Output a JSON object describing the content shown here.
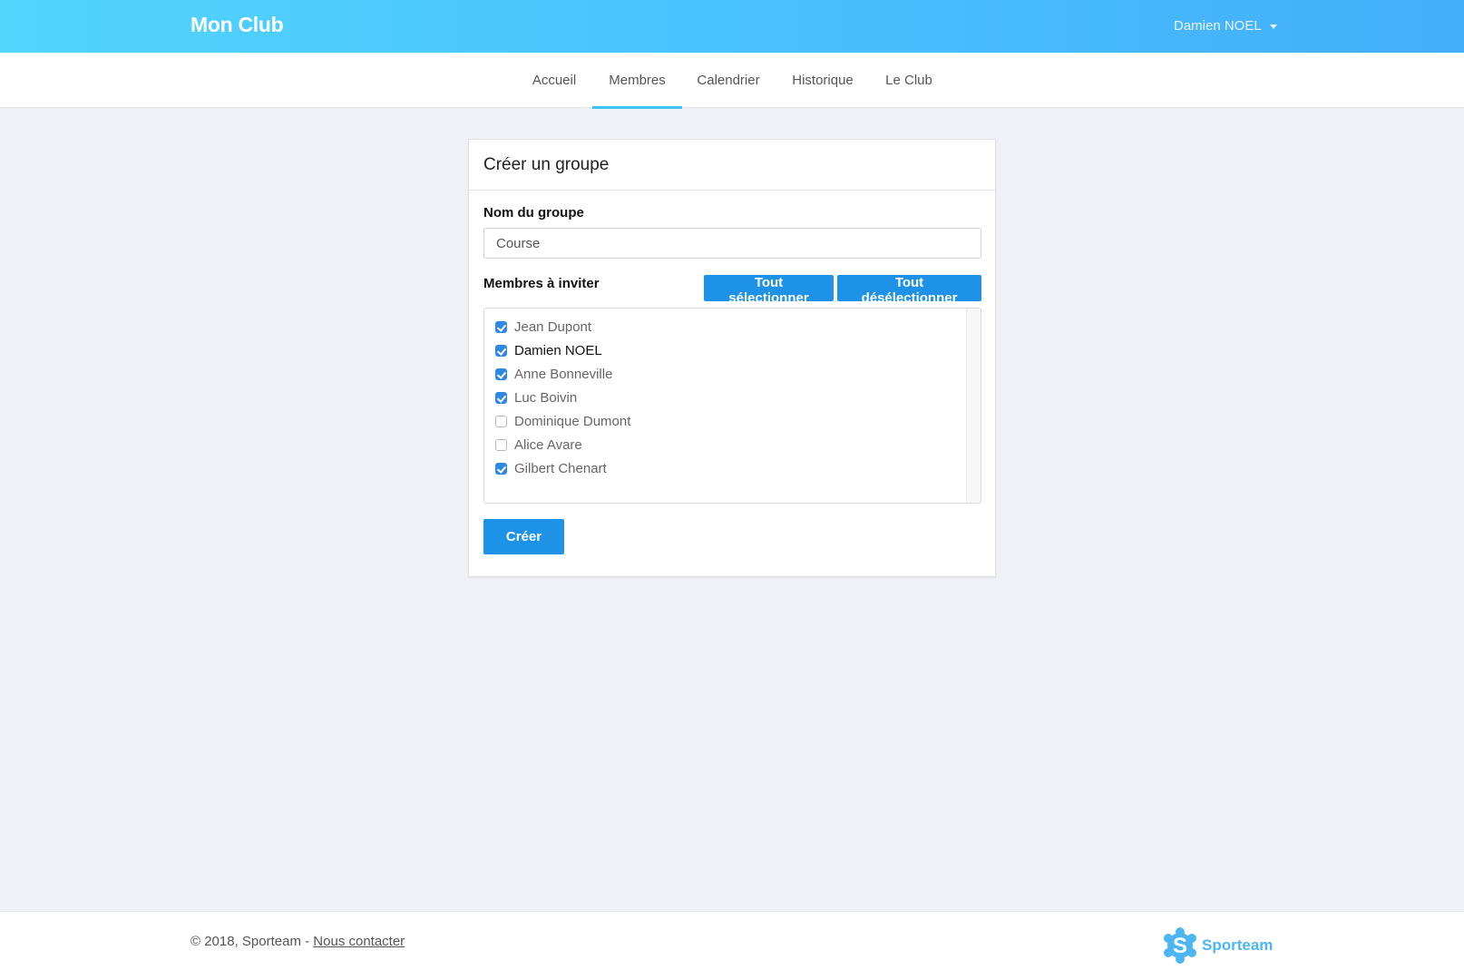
{
  "header": {
    "brand": "Mon Club",
    "user_name": "Damien NOEL"
  },
  "nav": {
    "items": [
      {
        "label": "Accueil"
      },
      {
        "label": "Membres"
      },
      {
        "label": "Calendrier"
      },
      {
        "label": "Historique"
      },
      {
        "label": "Le Club"
      }
    ],
    "active": "Membres"
  },
  "form": {
    "title": "Créer un groupe",
    "group_name_label": "Nom du groupe",
    "group_name_value": "Course",
    "members_label": "Membres à inviter",
    "select_all_label": "Tout sélectionner",
    "deselect_all_label": "Tout désélectionner",
    "members": [
      {
        "name": "Jean Dupont",
        "checked": true
      },
      {
        "name": "Damien NOEL",
        "checked": true
      },
      {
        "name": "Anne Bonneville",
        "checked": true
      },
      {
        "name": "Luc Boivin",
        "checked": true
      },
      {
        "name": "Dominique Dumont",
        "checked": false
      },
      {
        "name": "Alice Avare",
        "checked": false
      },
      {
        "name": "Gilbert Chenart",
        "checked": true
      }
    ],
    "submit_label": "Créer"
  },
  "footer": {
    "copyright": "© 2018, Sporteam - ",
    "contact_label": "Nous contacter",
    "logo_text": "Sporteam"
  },
  "colors": {
    "header_gradient_start": "#51d5fd",
    "header_gradient_end": "#43aefb",
    "primary_button": "#1e92e6",
    "active_tab_underline": "#3fc1f2",
    "checkbox_checked": "#2e88e4",
    "logo": "#4db6f2"
  }
}
